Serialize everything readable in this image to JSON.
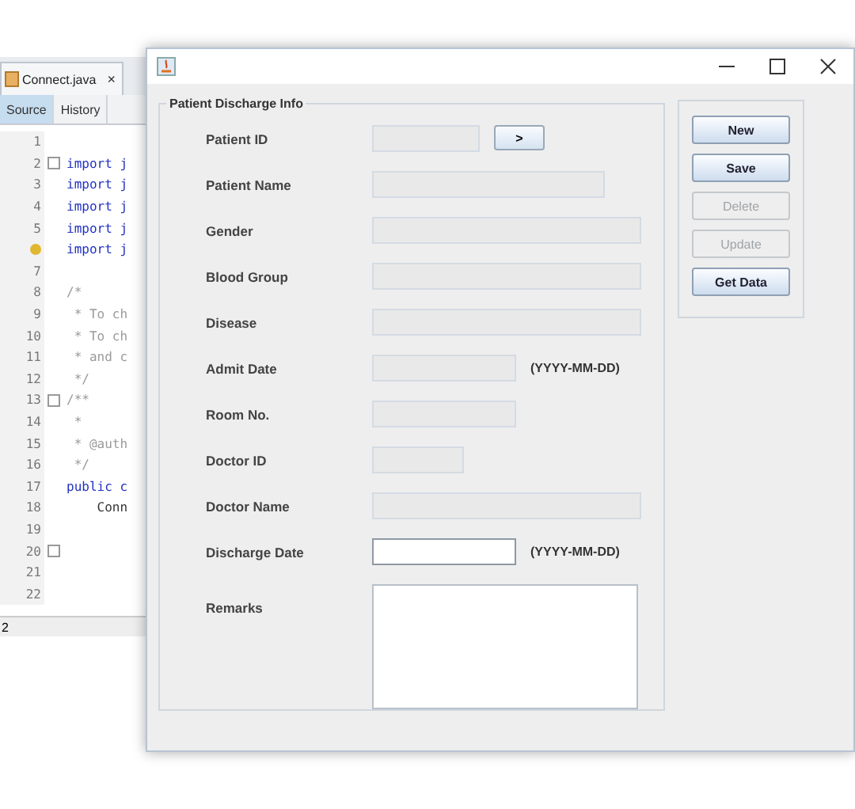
{
  "ide": {
    "file_tab": {
      "label": "Connect.java",
      "close": "×"
    },
    "view_tabs": [
      {
        "label": "Source",
        "selected": true
      },
      {
        "label": "History",
        "selected": false
      }
    ],
    "lines": [
      {
        "number": "1",
        "kind": "plain",
        "foldable": false
      },
      {
        "number": "2",
        "code": "import j",
        "kind": "keyword",
        "foldable": true
      },
      {
        "number": "3",
        "code": "import j",
        "kind": "keyword",
        "foldable": false
      },
      {
        "number": "4",
        "code": "import j",
        "kind": "keyword",
        "foldable": false
      },
      {
        "number": "5",
        "code": "import j",
        "kind": "keyword",
        "foldable": false
      },
      {
        "code": "import j",
        "kind": "keyword",
        "foldable": false,
        "hint": true
      },
      {
        "number": "7",
        "kind": "plain",
        "foldable": false
      },
      {
        "number": "8",
        "code": "/*",
        "kind": "comment",
        "foldable": false
      },
      {
        "number": "9",
        "code": " * To ch",
        "kind": "comment",
        "foldable": false
      },
      {
        "number": "10",
        "code": " * To ch",
        "kind": "comment",
        "foldable": false
      },
      {
        "number": "11",
        "code": " * and c",
        "kind": "comment",
        "foldable": false
      },
      {
        "number": "12",
        "code": " */",
        "kind": "comment",
        "foldable": false
      },
      {
        "number": "13",
        "code": "/**",
        "kind": "comment",
        "foldable": true
      },
      {
        "number": "14",
        "code": " *",
        "kind": "comment",
        "foldable": false
      },
      {
        "number": "15",
        "code": " * @auth",
        "kind": "comment",
        "foldable": false
      },
      {
        "number": "16",
        "code": " */",
        "kind": "comment",
        "foldable": false
      },
      {
        "number": "17",
        "code": "public c",
        "kind": "keyword",
        "foldable": false
      },
      {
        "number": "18",
        "code": "    Conn",
        "kind": "plain",
        "foldable": false
      },
      {
        "number": "19",
        "kind": "plain",
        "foldable": false
      },
      {
        "number": "20",
        "kind": "plain",
        "foldable": true
      },
      {
        "number": "21",
        "kind": "plain",
        "foldable": false
      },
      {
        "number": "22",
        "kind": "plain",
        "foldable": false
      }
    ],
    "status": "2"
  },
  "window": {
    "controls": [
      {
        "kind": "minimize"
      },
      {
        "kind": "maximize"
      },
      {
        "kind": "close"
      }
    ]
  },
  "form": {
    "title": "Patient Discharge Info",
    "fields": [
      {
        "label": "Patient ID",
        "kind": "text",
        "disabled": true,
        "button": ">"
      },
      {
        "label": "Patient Name",
        "kind": "text",
        "disabled": true
      },
      {
        "label": "Gender",
        "kind": "text",
        "disabled": true
      },
      {
        "label": "Blood Group",
        "kind": "text",
        "disabled": true
      },
      {
        "label": "Disease",
        "kind": "text",
        "disabled": true
      },
      {
        "label": "Admit Date",
        "kind": "text",
        "disabled": true,
        "hint": "(YYYY-MM-DD)"
      },
      {
        "label": "Room No.",
        "kind": "text",
        "disabled": true
      },
      {
        "label": "Doctor ID",
        "kind": "text",
        "disabled": true
      },
      {
        "label": "Doctor Name",
        "kind": "text",
        "disabled": true
      },
      {
        "label": "Discharge Date",
        "kind": "text",
        "disabled": false,
        "hint": "(YYYY-MM-DD)"
      },
      {
        "label": "Remarks",
        "kind": "textarea",
        "disabled": false
      }
    ]
  },
  "buttons": [
    {
      "label": "New",
      "disabled": false
    },
    {
      "label": "Save",
      "disabled": false
    },
    {
      "label": "Delete",
      "disabled": true
    },
    {
      "label": "Update",
      "disabled": true
    },
    {
      "label": "Get Data",
      "disabled": false
    }
  ]
}
